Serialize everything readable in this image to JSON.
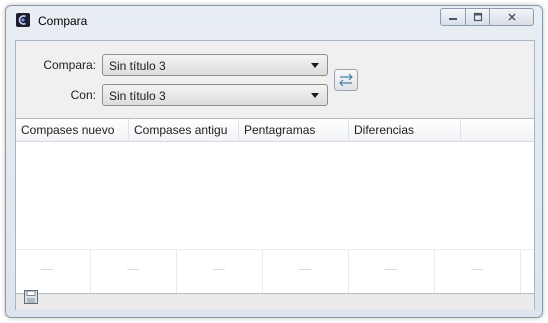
{
  "window": {
    "title": "Compara",
    "app_icon": "app-logo-icon"
  },
  "caption_buttons": [
    "minimize-icon",
    "maximize-icon",
    "close-icon"
  ],
  "form": {
    "compare_label": "Compara:",
    "compare_value": "Sin título 3",
    "with_label": "Con:",
    "with_value": "Sin título 3",
    "swap_icon": "swap-arrows-icon"
  },
  "table": {
    "columns": [
      "Compases nuevo",
      "Compases antigu",
      "Pentagramas",
      "Diferencias"
    ],
    "rows": []
  },
  "statusbar": {
    "save_icon": "floppy-disk-icon"
  }
}
